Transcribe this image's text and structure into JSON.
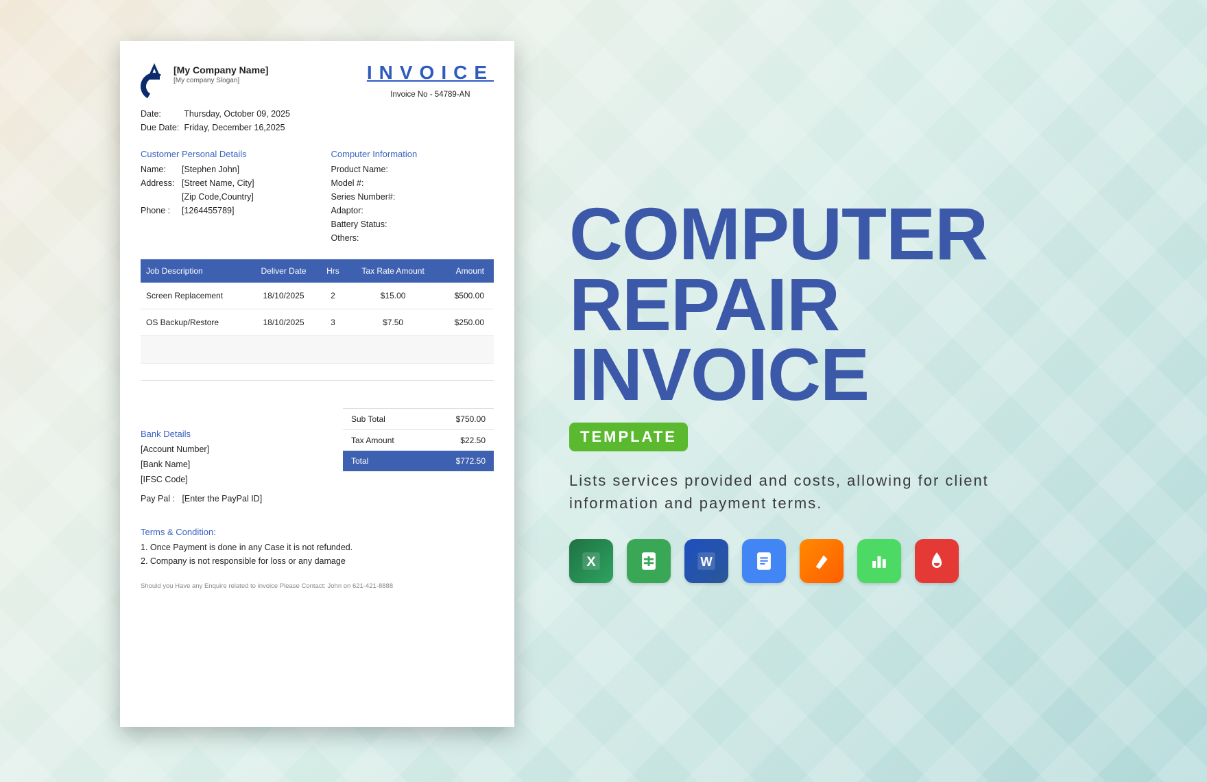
{
  "invoice": {
    "title": "INVOICE",
    "number_line": "Invoice No - 54789-AN",
    "company": {
      "name": "[My Company Name]",
      "slogan": "[My company Slogan]"
    },
    "dates": {
      "date_label": "Date:",
      "date_value": "Thursday, October 09, 2025",
      "due_label": "Due Date:",
      "due_value": "Friday, December 16,2025"
    },
    "customer": {
      "heading": "Customer Personal Details",
      "name_label": "Name:",
      "name_value": "[Stephen John]",
      "address_label": "Address:",
      "address_line1": "[Street Name, City]",
      "address_line2": "[Zip Code,Country]",
      "phone_label": "Phone :",
      "phone_value": "[1264455789]"
    },
    "computer": {
      "heading": "Computer Information",
      "labels": {
        "product": "Product Name:",
        "model": "Model #:",
        "series": "Series Number#:",
        "adaptor": "Adaptor:",
        "battery": "Battery Status:",
        "others": "Others:"
      }
    },
    "table": {
      "headers": {
        "desc": "Job Description",
        "date": "Deliver Date",
        "hrs": "Hrs",
        "tax": "Tax Rate Amount",
        "amount": "Amount"
      },
      "rows": [
        {
          "desc": "Screen Replacement",
          "date": "18/10/2025",
          "hrs": "2",
          "tax": "$15.00",
          "amount": "$500.00"
        },
        {
          "desc": "OS Backup/Restore",
          "date": "18/10/2025",
          "hrs": "3",
          "tax": "$7.50",
          "amount": "$250.00"
        }
      ]
    },
    "totals": {
      "subtotal_label": "Sub Total",
      "subtotal_value": "$750.00",
      "tax_label": "Tax Amount",
      "tax_value": "$22.50",
      "total_label": "Total",
      "total_value": "$772.50"
    },
    "bank": {
      "heading": "Bank Details",
      "account": "[Account Number]",
      "bank_name": "[Bank Name]",
      "ifsc": "[IFSC Code]",
      "paypal_label": "Pay Pal :",
      "paypal_value": "[Enter the PayPal ID]"
    },
    "terms": {
      "heading": "Terms & Condition:",
      "items": [
        "1. Once Payment is done in any Case it is not refunded.",
        "2. Company is not responsible for loss or any damage"
      ]
    },
    "footer": "Should you Have any Enquire related to invoice Please Contact: John on 621-421-8888"
  },
  "promo": {
    "title_line1": "Computer",
    "title_line2": "Repair Invoice",
    "badge": "TEMPLATE",
    "desc": "Lists services provided and costs, allowing for client information and payment terms.",
    "formats": [
      "Excel",
      "Google Sheets",
      "Word",
      "Google Docs",
      "Pages",
      "Numbers",
      "PDF"
    ]
  }
}
